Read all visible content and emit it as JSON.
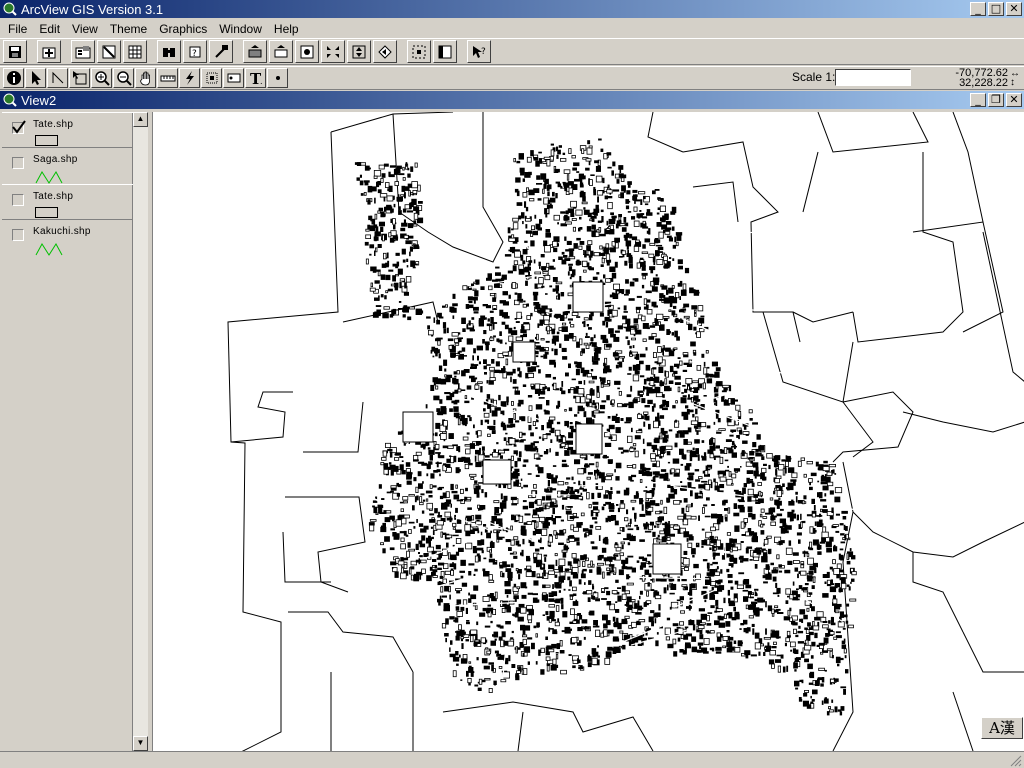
{
  "app": {
    "title": "ArcView GIS Version 3.1"
  },
  "menu": [
    "File",
    "Edit",
    "View",
    "Theme",
    "Graphics",
    "Window",
    "Help"
  ],
  "toolbar_buttons": [
    "save-icon",
    "add-theme-icon",
    "theme-properties-icon",
    "edit-legend-icon",
    "open-table-icon",
    "find-icon",
    "locate-address-icon",
    "query-builder-icon",
    "zoom-full-extent-icon",
    "zoom-to-themes-icon",
    "zoom-to-selected-icon",
    "zoom-in-fixed-icon",
    "zoom-out-fixed-icon",
    "zoom-previous-icon",
    "select-by-theme-icon",
    "clear-selection-icon",
    "help-icon"
  ],
  "tools": [
    "identify-icon",
    "pointer-icon",
    "vertex-edit-icon",
    "select-feature-icon",
    "zoom-in-icon",
    "zoom-out-icon",
    "pan-icon",
    "measure-icon",
    "hotlink-icon",
    "area-of-interest-icon",
    "label-icon",
    "text-icon",
    "draw-point-icon"
  ],
  "scale": {
    "label": "Scale 1:",
    "value": ""
  },
  "coords": {
    "x": "-70,772.62",
    "y": "32,228.22"
  },
  "view": {
    "title": "View2"
  },
  "themes": [
    {
      "name": "Tate.shp",
      "checked": true,
      "symbol": "polygon"
    },
    {
      "name": "Saga.shp",
      "checked": false,
      "symbol": "line"
    },
    {
      "name": "Tate.shp",
      "checked": false,
      "symbol": "polygon"
    },
    {
      "name": "Kakuchi.shp",
      "checked": false,
      "symbol": "line"
    }
  ],
  "ime": {
    "label": "A漢"
  },
  "colors": {
    "title_start": "#0a246a",
    "title_end": "#a6caf0",
    "line_symbol": "#00c000"
  }
}
